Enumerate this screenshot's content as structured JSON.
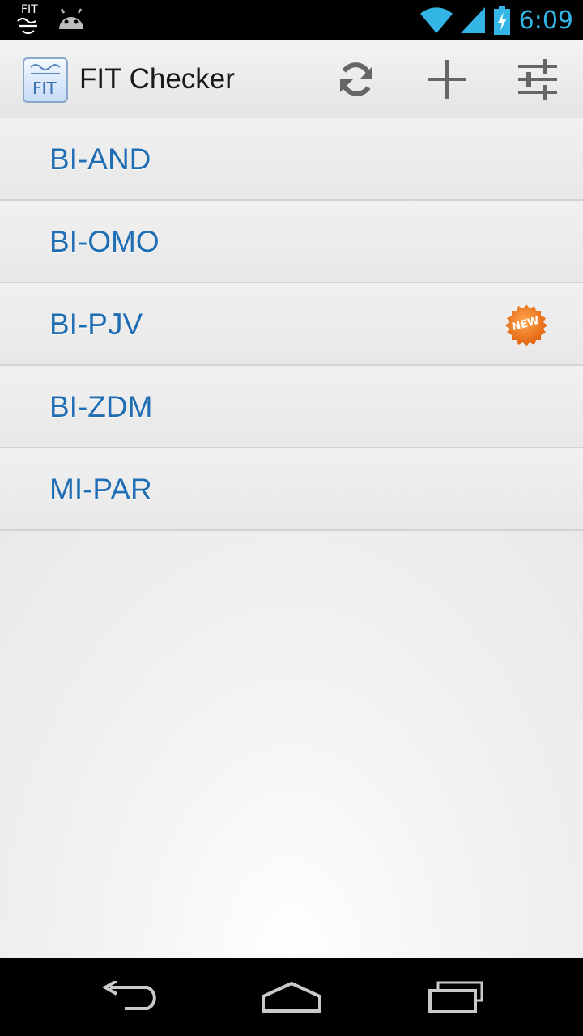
{
  "status_bar": {
    "clock": "6:09",
    "notification_icon_text": "FIT",
    "icons": [
      "fit-notification-icon",
      "android-icon",
      "wifi-icon",
      "signal-icon",
      "battery-charging-icon"
    ]
  },
  "action_bar": {
    "title": "FIT Checker",
    "app_icon_text": "FIT",
    "actions": [
      "refresh-icon",
      "add-icon",
      "settings-sliders-icon"
    ]
  },
  "list": {
    "items": [
      {
        "label": "BI-AND",
        "is_new": false
      },
      {
        "label": "BI-OMO",
        "is_new": false
      },
      {
        "label": "BI-PJV",
        "is_new": true,
        "badge": "NEW"
      },
      {
        "label": "BI-ZDM",
        "is_new": false
      },
      {
        "label": "MI-PAR",
        "is_new": false
      }
    ]
  },
  "nav_bar": {
    "buttons": [
      "back-icon",
      "home-icon",
      "recent-apps-icon"
    ]
  },
  "colors": {
    "accent": "#33b5e5",
    "item_text": "#1f6db3",
    "badge": "#f07a1c"
  }
}
